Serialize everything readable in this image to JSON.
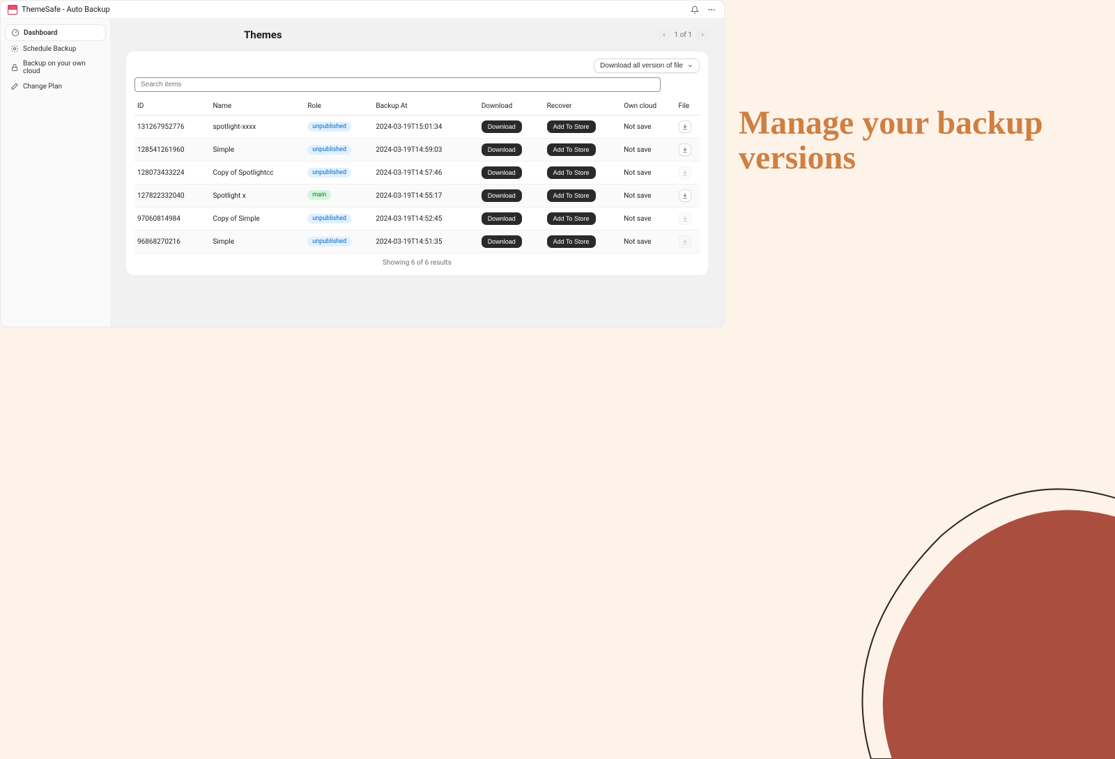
{
  "titlebar": {
    "title": "ThemeSafe - Auto Backup"
  },
  "sidebar": {
    "items": [
      {
        "label": "Dashboard",
        "icon": "dashboard-icon",
        "active": true
      },
      {
        "label": "Schedule Backup",
        "icon": "gear-icon",
        "active": false
      },
      {
        "label": "Backup on your own cloud",
        "icon": "lock-icon",
        "active": false
      },
      {
        "label": "Change Plan",
        "icon": "edit-icon",
        "active": false
      }
    ]
  },
  "main": {
    "title": "Themes",
    "pager": "1 of 1",
    "download_all_label": "Download all version of file",
    "search_placeholder": "Search items"
  },
  "columns": {
    "id": "ID",
    "name": "Name",
    "role": "Role",
    "backup": "Backup At",
    "download": "Download",
    "recover": "Recover",
    "cloud": "Own cloud",
    "file": "File"
  },
  "actions": {
    "download": "Download",
    "recover": "Add To Store"
  },
  "rows": [
    {
      "id": "131267952776",
      "name": "spotlight-xxxx",
      "role": "unpublished",
      "role_type": "unpub",
      "backup_at": "2024-03-19T15:01:34",
      "cloud": "Not save",
      "file_enabled": true
    },
    {
      "id": "128541261960",
      "name": "Simple",
      "role": "unpublished",
      "role_type": "unpub",
      "backup_at": "2024-03-19T14:59:03",
      "cloud": "Not save",
      "file_enabled": true
    },
    {
      "id": "128073433224",
      "name": "Copy of Spotlightcc",
      "role": "unpublished",
      "role_type": "unpub",
      "backup_at": "2024-03-19T14:57:46",
      "cloud": "Not save",
      "file_enabled": false
    },
    {
      "id": "127822332040",
      "name": "Spotlight x",
      "role": "main",
      "role_type": "main",
      "backup_at": "2024-03-19T14:55:17",
      "cloud": "Not save",
      "file_enabled": true
    },
    {
      "id": "97060814984",
      "name": "Copy of Simple",
      "role": "unpublished",
      "role_type": "unpub",
      "backup_at": "2024-03-19T14:52:45",
      "cloud": "Not save",
      "file_enabled": false
    },
    {
      "id": "96868270216",
      "name": "Simple",
      "role": "unpublished",
      "role_type": "unpub",
      "backup_at": "2024-03-19T14:51:35",
      "cloud": "Not save",
      "file_enabled": false
    }
  ],
  "footer": "Showing 6 of 6 results",
  "headline_a": "Manage your backup",
  "headline_b": "versions"
}
